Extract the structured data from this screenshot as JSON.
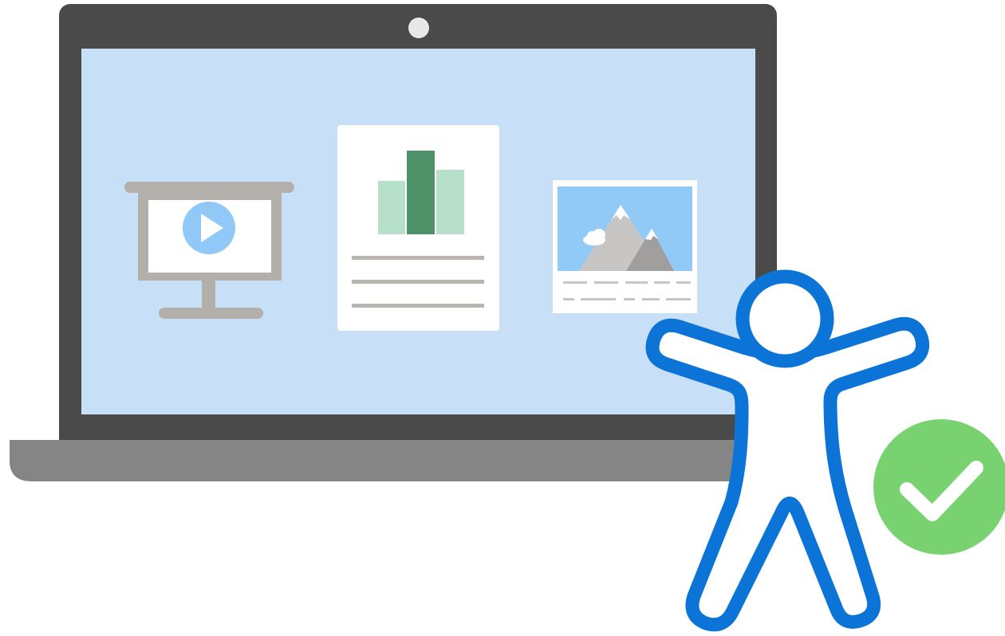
{
  "scene": {
    "subject": "accessibility-illustration",
    "icons": [
      "laptop-icon",
      "presentation-icon",
      "play-icon",
      "document-icon",
      "bar-chart-icon",
      "image-icon",
      "mountain-icon",
      "cloud-icon",
      "accessibility-person-icon",
      "checkmark-icon"
    ]
  },
  "colors": {
    "laptop_frame": "#4a4a4a",
    "laptop_base": "#858585",
    "screen": "#c7e0f8",
    "easel": "#b3afab",
    "play_circle": "#90c8f8",
    "chart_dark": "#4f9168",
    "chart_light": "#b6e0c9",
    "doc_lines": "#b8b4b0",
    "sky": "#91c9f7",
    "mountain": "#c8c6c4",
    "mountain_dark": "#a19f9d",
    "accessibility_blue": "#0b74d6",
    "check_green": "#78d26f"
  }
}
